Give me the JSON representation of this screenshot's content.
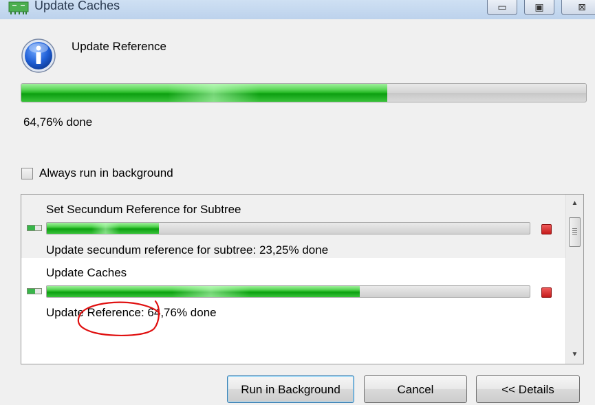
{
  "window": {
    "title": "Update Caches",
    "controls": {
      "minimize": "▭",
      "maximize": "▣",
      "close": "⊠"
    }
  },
  "main": {
    "task_name": "Update Reference",
    "progress_fraction": 0.6476,
    "status": "64,76% done"
  },
  "options": {
    "always_background_label": "Always run in background",
    "always_background_checked": false
  },
  "jobs": [
    {
      "title": "Set Secundum Reference for Subtree",
      "progress_fraction": 0.2325,
      "status": "Update secundum reference for subtree:  23,25% done"
    },
    {
      "title": "Update Caches",
      "progress_fraction": 0.6476,
      "status": "Update Reference:  64,76% done"
    }
  ],
  "buttons": {
    "run_in_background": "Run in Background",
    "cancel": "Cancel",
    "details": "<< Details"
  },
  "colors": {
    "progress_green": "#22b622",
    "stop_red": "#c41b1b",
    "annotation_red": "#e01010"
  },
  "icons": {
    "app": "app-logo-icon",
    "info": "info-icon",
    "job": "job-progress-icon",
    "stop": "stop-icon"
  }
}
